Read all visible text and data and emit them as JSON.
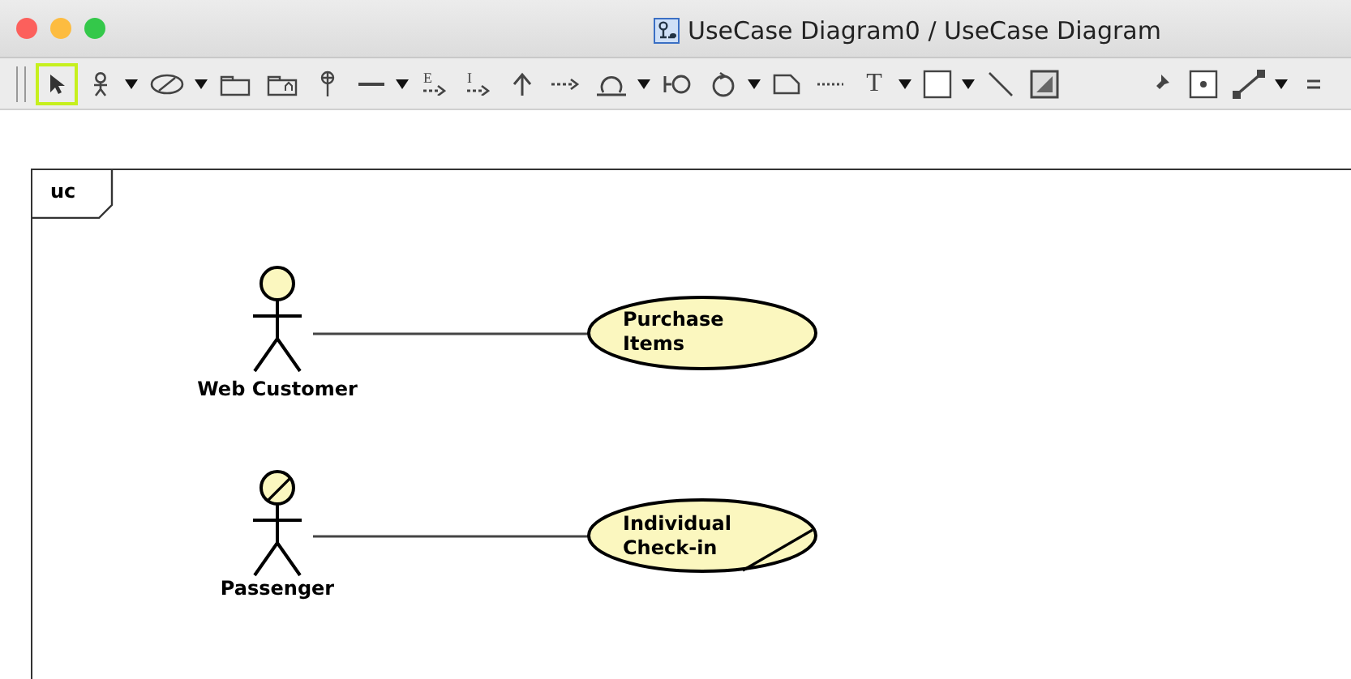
{
  "window": {
    "title": "UseCase Diagram0 / UseCase Diagram"
  },
  "toolbar": [
    {
      "kind": "select",
      "selected": true
    },
    {
      "kind": "actor",
      "selected": false,
      "dropdown": true
    },
    {
      "kind": "usecase",
      "selected": false,
      "dropdown": true
    },
    {
      "kind": "package",
      "selected": false
    },
    {
      "kind": "subsystem",
      "selected": false
    },
    {
      "kind": "pin",
      "selected": false
    },
    {
      "kind": "line",
      "selected": false,
      "dropdown": true
    },
    {
      "kind": "extend",
      "selected": false,
      "glyph": "E"
    },
    {
      "kind": "include",
      "selected": false,
      "glyph": "I"
    },
    {
      "kind": "generalization",
      "selected": false
    },
    {
      "kind": "dependency",
      "selected": false
    },
    {
      "kind": "boundary",
      "selected": false,
      "dropdown": true
    },
    {
      "kind": "interface",
      "selected": false
    },
    {
      "kind": "control",
      "selected": false,
      "dropdown": true
    },
    {
      "kind": "note",
      "selected": false
    },
    {
      "kind": "dotted",
      "selected": false
    },
    {
      "kind": "text",
      "selected": false,
      "glyph": "T",
      "dropdown": true
    },
    {
      "kind": "rect",
      "selected": false,
      "dropdown": true
    },
    {
      "kind": "diagonal",
      "selected": false
    },
    {
      "kind": "image",
      "selected": false
    },
    {
      "kind": "pushpin",
      "selected": false,
      "gap_before": true
    },
    {
      "kind": "dotbox",
      "selected": false
    },
    {
      "kind": "connector",
      "selected": false,
      "dropdown": true
    },
    {
      "kind": "parallel",
      "selected": false
    }
  ],
  "diagram": {
    "frame_label": "uc",
    "associations": [
      {
        "actor": {
          "name": "Web Customer",
          "annotated": false
        },
        "use_case": {
          "lines": [
            "Purchase",
            "Items"
          ],
          "annotated": false
        }
      },
      {
        "actor": {
          "name": "Passenger",
          "annotated": true
        },
        "use_case": {
          "lines": [
            "Individual",
            "Check-in"
          ],
          "annotated": true
        }
      }
    ]
  }
}
